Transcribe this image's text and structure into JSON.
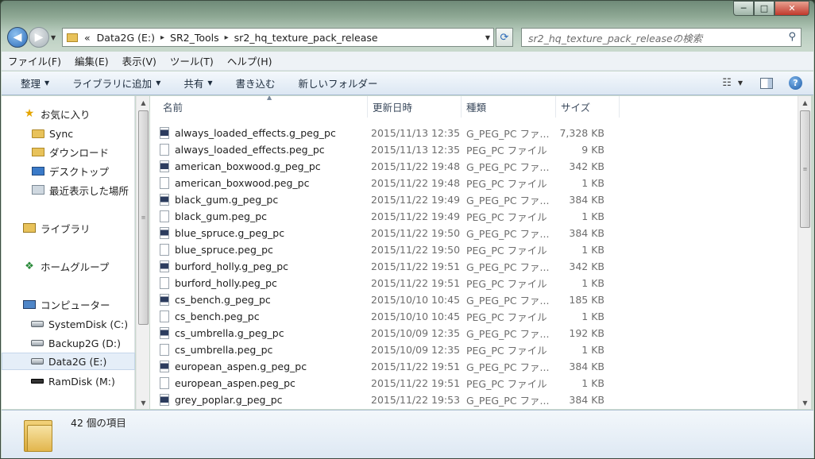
{
  "window": {
    "caption": {
      "minimize": "─",
      "maximize": "□",
      "close": "✕"
    }
  },
  "address_bar": {
    "overflow": "«",
    "segments": [
      "Data2G (E:)",
      "SR2_Tools",
      "sr2_hq_texture_pack_release"
    ],
    "separator": "▸"
  },
  "search": {
    "placeholder": "sr2_hq_texture_pack_releaseの検索"
  },
  "menubar": {
    "items": [
      "ファイル(F)",
      "編集(E)",
      "表示(V)",
      "ツール(T)",
      "ヘルプ(H)"
    ]
  },
  "toolbar": {
    "organize": "整理",
    "add_to_library": "ライブラリに追加",
    "share": "共有",
    "burn": "書き込む",
    "new_folder": "新しいフォルダー"
  },
  "sidebar": {
    "items": [
      {
        "label": "お気に入り",
        "icon": "star-icon"
      },
      {
        "label": "Sync",
        "icon": "folder-icon"
      },
      {
        "label": "ダウンロード",
        "icon": "downloads-folder-icon"
      },
      {
        "label": "デスクトップ",
        "icon": "desktop-icon"
      },
      {
        "label": "最近表示した場所",
        "icon": "recent-places-icon"
      },
      {
        "label": "ライブラリ",
        "icon": "library-icon"
      },
      {
        "label": "ホームグループ",
        "icon": "homegroup-icon"
      },
      {
        "label": "コンピューター",
        "icon": "computer-icon"
      },
      {
        "label": "SystemDisk (C:)",
        "icon": "system-drive-icon"
      },
      {
        "label": "Backup2G (D:)",
        "icon": "drive-icon"
      },
      {
        "label": "Data2G (E:)",
        "icon": "drive-icon",
        "selected": true
      },
      {
        "label": "RamDisk (M:)",
        "icon": "ramdisk-icon"
      }
    ]
  },
  "columns": {
    "name": "名前",
    "date": "更新日時",
    "type": "種類",
    "size": "サイズ"
  },
  "files": [
    {
      "name": "always_loaded_effects.g_peg_pc",
      "date": "2015/11/13 12:35",
      "type": "G_PEG_PC ファ...",
      "size": "7,328 KB",
      "g": true
    },
    {
      "name": "always_loaded_effects.peg_pc",
      "date": "2015/11/13 12:35",
      "type": "PEG_PC ファイル",
      "size": "9 KB",
      "g": false
    },
    {
      "name": "american_boxwood.g_peg_pc",
      "date": "2015/11/22 19:48",
      "type": "G_PEG_PC ファ...",
      "size": "342 KB",
      "g": true
    },
    {
      "name": "american_boxwood.peg_pc",
      "date": "2015/11/22 19:48",
      "type": "PEG_PC ファイル",
      "size": "1 KB",
      "g": false
    },
    {
      "name": "black_gum.g_peg_pc",
      "date": "2015/11/22 19:49",
      "type": "G_PEG_PC ファ...",
      "size": "384 KB",
      "g": true
    },
    {
      "name": "black_gum.peg_pc",
      "date": "2015/11/22 19:49",
      "type": "PEG_PC ファイル",
      "size": "1 KB",
      "g": false
    },
    {
      "name": "blue_spruce.g_peg_pc",
      "date": "2015/11/22 19:50",
      "type": "G_PEG_PC ファ...",
      "size": "384 KB",
      "g": true
    },
    {
      "name": "blue_spruce.peg_pc",
      "date": "2015/11/22 19:50",
      "type": "PEG_PC ファイル",
      "size": "1 KB",
      "g": false
    },
    {
      "name": "burford_holly.g_peg_pc",
      "date": "2015/11/22 19:51",
      "type": "G_PEG_PC ファ...",
      "size": "342 KB",
      "g": true
    },
    {
      "name": "burford_holly.peg_pc",
      "date": "2015/11/22 19:51",
      "type": "PEG_PC ファイル",
      "size": "1 KB",
      "g": false
    },
    {
      "name": "cs_bench.g_peg_pc",
      "date": "2015/10/10 10:45",
      "type": "G_PEG_PC ファ...",
      "size": "185 KB",
      "g": true
    },
    {
      "name": "cs_bench.peg_pc",
      "date": "2015/10/10 10:45",
      "type": "PEG_PC ファイル",
      "size": "1 KB",
      "g": false
    },
    {
      "name": "cs_umbrella.g_peg_pc",
      "date": "2015/10/09 12:35",
      "type": "G_PEG_PC ファ...",
      "size": "192 KB",
      "g": true
    },
    {
      "name": "cs_umbrella.peg_pc",
      "date": "2015/10/09 12:35",
      "type": "PEG_PC ファイル",
      "size": "1 KB",
      "g": false
    },
    {
      "name": "european_aspen.g_peg_pc",
      "date": "2015/11/22 19:51",
      "type": "G_PEG_PC ファ...",
      "size": "384 KB",
      "g": true
    },
    {
      "name": "european_aspen.peg_pc",
      "date": "2015/11/22 19:51",
      "type": "PEG_PC ファイル",
      "size": "1 KB",
      "g": false
    },
    {
      "name": "grey_poplar.g_peg_pc",
      "date": "2015/11/22 19:53",
      "type": "G_PEG_PC ファ...",
      "size": "384 KB",
      "g": true
    }
  ],
  "status": {
    "item_count": "42 個の項目"
  }
}
